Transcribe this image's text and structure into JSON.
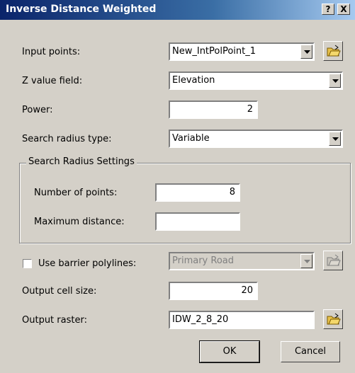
{
  "window": {
    "title": "Inverse Distance Weighted",
    "help_button": "?",
    "close_button": "X"
  },
  "input_points": {
    "label": "Input points:",
    "value": "New_IntPolPoint_1"
  },
  "z_value_field": {
    "label": "Z value field:",
    "value": "Elevation"
  },
  "power": {
    "label": "Power:",
    "value": "2"
  },
  "search_radius_type": {
    "label": "Search radius type:",
    "value": "Variable"
  },
  "search_radius_settings": {
    "group_label": "Search Radius Settings",
    "number_of_points": {
      "label": "Number of points:",
      "value": "8"
    },
    "maximum_distance": {
      "label": "Maximum distance:",
      "value": ""
    }
  },
  "barrier": {
    "label": "Use barrier polylines:",
    "checked": false,
    "value": "Primary Road"
  },
  "output_cell_size": {
    "label": "Output cell size:",
    "value": "20"
  },
  "output_raster": {
    "label": "Output raster:",
    "value": "IDW_2_8_20"
  },
  "buttons": {
    "ok": "OK",
    "cancel": "Cancel"
  },
  "icons": {
    "folder": "open-folder-icon",
    "dropdown": "chevron-down-icon",
    "help": "help-icon",
    "close": "close-icon"
  },
  "colors": {
    "titlebar_start": "#0a246a",
    "titlebar_end": "#a6caf0",
    "dialog_bg": "#d4d0c8"
  }
}
